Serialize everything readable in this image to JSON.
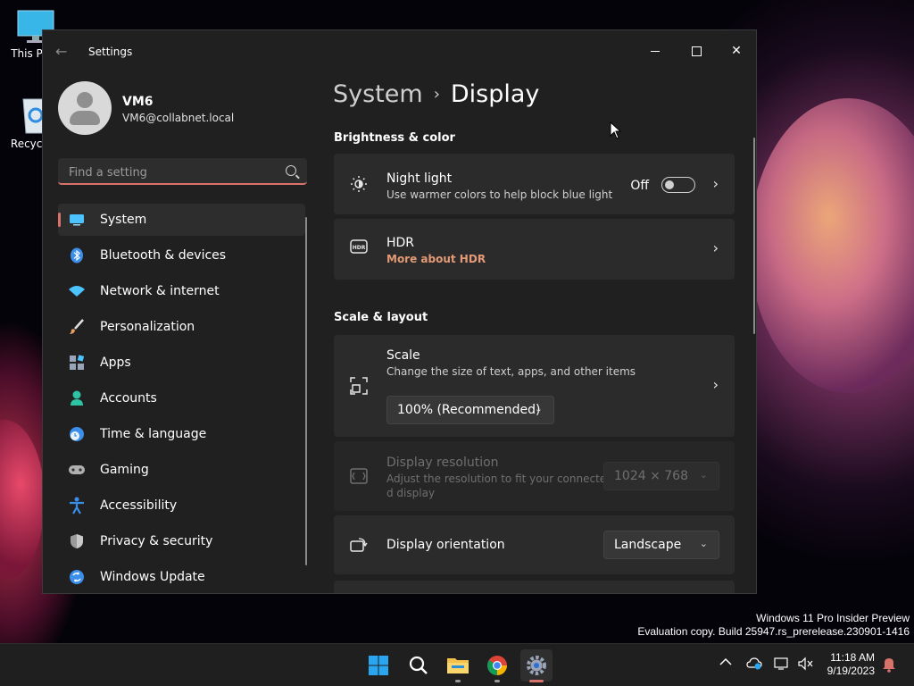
{
  "desktop": {
    "icons": [
      {
        "label": "This P"
      },
      {
        "label": "Recycle"
      }
    ],
    "watermark_line1": "Windows 11 Pro Insider Preview",
    "watermark_line2": "Evaluation copy. Build 25947.rs_prerelease.230901-1416"
  },
  "window": {
    "title": "Settings",
    "back_icon": "back-arrow-icon",
    "controls": {
      "minimize": "—",
      "maximize": "☐",
      "close": "✕"
    }
  },
  "user": {
    "name": "VM6",
    "email": "VM6@collabnet.local"
  },
  "search": {
    "placeholder": "Find a setting",
    "value": ""
  },
  "nav": {
    "items": [
      {
        "label": "System",
        "icon": "monitor-icon",
        "color": "#4cc2ff",
        "active": true
      },
      {
        "label": "Bluetooth & devices",
        "icon": "bluetooth-icon",
        "color": "#3b8eea"
      },
      {
        "label": "Network & internet",
        "icon": "wifi-icon",
        "color": "#4cc2ff"
      },
      {
        "label": "Personalization",
        "icon": "paintbrush-icon",
        "color": "#e8a060"
      },
      {
        "label": "Apps",
        "icon": "apps-icon",
        "color": "#9aa4b8"
      },
      {
        "label": "Accounts",
        "icon": "person-icon",
        "color": "#2fc3a6"
      },
      {
        "label": "Time & language",
        "icon": "globe-clock-icon",
        "color": "#4cc2ff"
      },
      {
        "label": "Gaming",
        "icon": "gamepad-icon",
        "color": "#b0b0b0"
      },
      {
        "label": "Accessibility",
        "icon": "accessibility-icon",
        "color": "#3b8eea"
      },
      {
        "label": "Privacy & security",
        "icon": "shield-icon",
        "color": "#9a9a9a"
      },
      {
        "label": "Windows Update",
        "icon": "update-icon",
        "color": "#3b8eea"
      }
    ]
  },
  "breadcrumb": {
    "parent": "System",
    "separator": "›",
    "current": "Display"
  },
  "sections": {
    "brightness": {
      "title": "Brightness & color",
      "night_light": {
        "title": "Night light",
        "subtitle": "Use warmer colors to help block blue light",
        "state": "Off"
      },
      "hdr": {
        "title": "HDR",
        "link": "More about HDR"
      }
    },
    "scale_layout": {
      "title": "Scale & layout",
      "scale": {
        "title": "Scale",
        "subtitle": "Change the size of text, apps, and other items",
        "value": "100% (Recommended)"
      },
      "resolution": {
        "title": "Display resolution",
        "subtitle_line1": "Adjust the resolution to fit your connecte",
        "subtitle_line2": "d display",
        "value": "1024 × 768"
      },
      "orientation": {
        "title": "Display orientation",
        "value": "Landscape"
      }
    }
  },
  "taskbar": {
    "apps": [
      "start-icon",
      "search-icon",
      "file-explorer-icon",
      "chrome-icon",
      "settings-icon"
    ],
    "time": "11:18 AM",
    "date": "9/19/2023"
  },
  "colors": {
    "accent": "#d9726a",
    "link": "#e39a76"
  }
}
